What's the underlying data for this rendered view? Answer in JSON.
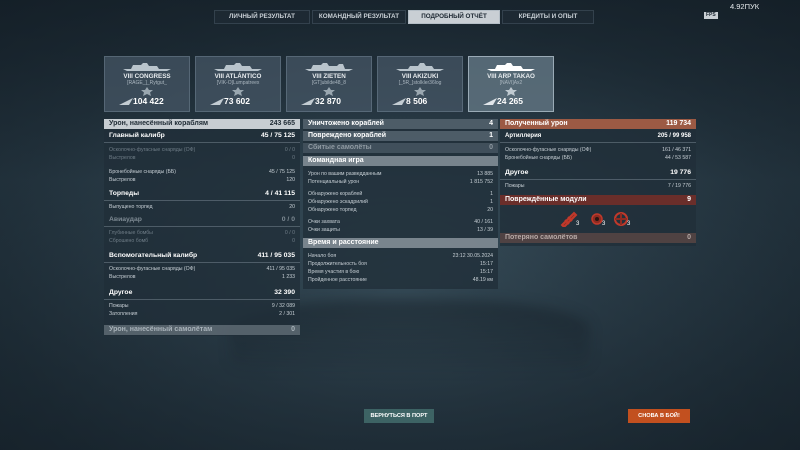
{
  "topbar": {
    "tabs": [
      "ЛИЧНЫЙ РЕЗУЛЬТАТ",
      "КОМАНДНЫЙ РЕЗУЛЬТАТ",
      "ПОДРОБНЫЙ ОТЧЁТ",
      "КРЕДИТЫ И ОПЫТ"
    ],
    "active_tab": "ПОДРОБНЫЙ ОТЧЁТ",
    "fps_badge": "FPS",
    "points": "4.92ПУК"
  },
  "ships": [
    {
      "name": "VIII CONGRESS",
      "player": "[RAGE_]_Rytgut_",
      "damage": "104 422"
    },
    {
      "name": "VIII ATLÁNTICO",
      "player": "[VIK-O]Lumpatreex",
      "damage": "73 602"
    },
    {
      "name": "VIII ZIETEN",
      "player": "[GT]ubilde48_8",
      "damage": "32 870"
    },
    {
      "name": "VIII AKIZUKI",
      "player": "[_5R_]stolkler36log",
      "damage": "8 506"
    },
    {
      "name": "VIII ARP TAKAO",
      "player": "[NAVI]Ax2",
      "damage": "24 265"
    }
  ],
  "left": {
    "damage_header": {
      "label": "Урон, нанесённый кораблям",
      "value": "243 665"
    },
    "main_battery": {
      "label": "Главный калибр",
      "value": "45 / 75 125"
    },
    "he_shells": {
      "label": "Осколочно-фугасные снаряды (ОФ)",
      "value": "0 / 0"
    },
    "he_fired": {
      "label": "Выстрелов",
      "value": "0"
    },
    "ap_shells": {
      "label": "Бронебойные снаряды (ББ)",
      "value": "45 / 75 125"
    },
    "ap_fired": {
      "label": "Выстрелов",
      "value": "120"
    },
    "torpedoes": {
      "label": "Торпеды",
      "value": "4 / 41 115"
    },
    "torps_fired": {
      "label": "Выпущено торпед",
      "value": "20"
    },
    "air_strike": {
      "label": "Авиаудар",
      "value": "0 / 0"
    },
    "depth_charges": {
      "label": "Глубинные бомбы",
      "value": "0 / 0"
    },
    "bombs_dropped": {
      "label": "Сброшено бомб",
      "value": "0"
    },
    "secondary": {
      "label": "Вспомогательный калибр",
      "value": "411 / 95 035"
    },
    "sec_he": {
      "label": "Осколочно-фугасные снаряды (ОФ)",
      "value": "411 / 95 035"
    },
    "sec_fired": {
      "label": "Выстрелов",
      "value": "1 233"
    },
    "other": {
      "label": "Другое",
      "value": "32 390"
    },
    "fires": {
      "label": "Пожары",
      "value": "9 / 32 089"
    },
    "floods": {
      "label": "Затопления",
      "value": "2 / 301"
    },
    "aircraft_damage": {
      "label": "Урон, нанесённый самолётам",
      "value": "0"
    }
  },
  "middle": {
    "destroyed": {
      "label": "Уничтожено кораблей",
      "value": "4"
    },
    "damaged": {
      "label": "Повреждено кораблей",
      "value": "1"
    },
    "planes": {
      "label": "Сбитые самолёты",
      "value": "0"
    },
    "team_header": "Командная игра",
    "spotting_damage": {
      "label": "Урон по вашим разведданным",
      "value": "13 885"
    },
    "potential_damage": {
      "label": "Потенциальный урон",
      "value": "1 815 752"
    },
    "spotted_ships": {
      "label": "Обнаружено кораблей",
      "value": "1"
    },
    "spotted_squadrons": {
      "label": "Обнаружено эскадрилий",
      "value": "1"
    },
    "spotted_torps": {
      "label": "Обнаружено торпед",
      "value": "20"
    },
    "capture_points": {
      "label": "Очки захвата",
      "value": "40 / 161"
    },
    "defense_points": {
      "label": "Очки защиты",
      "value": "13 / 39"
    },
    "time_header": "Время и расстояние",
    "battle_start": {
      "label": "Начало боя",
      "value": "23:12   30.05.2024"
    },
    "battle_duration": {
      "label": "Продолжительность боя",
      "value": "15:17"
    },
    "time_in_battle": {
      "label": "Время участия в бою",
      "value": "15:17"
    },
    "distance": {
      "label": "Пройденное расстояние",
      "value": "48.19 км"
    }
  },
  "right": {
    "received_header": {
      "label": "Полученный урон",
      "value": "119 734"
    },
    "artillery": {
      "label": "Артиллерия",
      "value": "205 / 99 958"
    },
    "r_he": {
      "label": "Осколочно-фугасные снаряды (ОФ)",
      "value": "161 / 46 371"
    },
    "r_ap": {
      "label": "Бронебойные снаряды (ББ)",
      "value": "44 / 53 587"
    },
    "r_other": {
      "label": "Другое",
      "value": "19 776"
    },
    "r_fires": {
      "label": "Пожары",
      "value": "7 / 19 776"
    },
    "damaged_modules": {
      "label": "Повреждённые модули",
      "value": "9"
    },
    "modules": [
      {
        "icon": "gun-turret-icon",
        "count": "3"
      },
      {
        "icon": "engine-icon",
        "count": "3"
      },
      {
        "icon": "steering-icon",
        "count": "3"
      }
    ],
    "lost_planes": {
      "label": "Потеряно самолётов",
      "value": "0"
    }
  },
  "buttons": {
    "port": "ВЕРНУТЬСЯ В ПОРТ",
    "battle": "СНОВА В БОЙ!"
  },
  "colors": {
    "received_header": "#9c5a44",
    "modules_header": "#6a2e2a",
    "battle_button": "#c2501f",
    "port_button": "#3d6364"
  }
}
